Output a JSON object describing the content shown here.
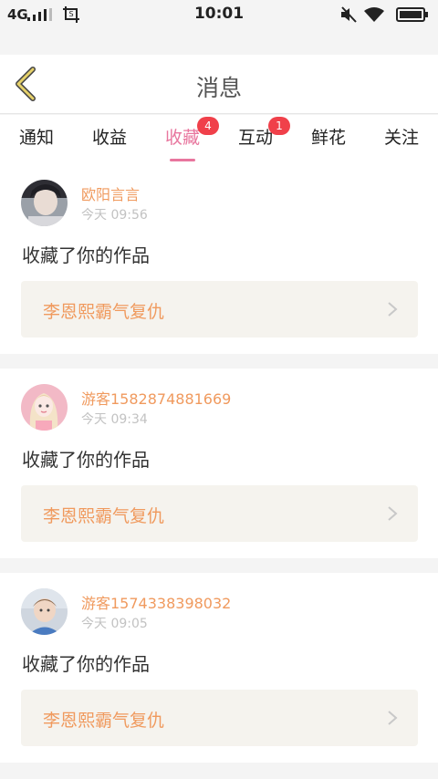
{
  "status_bar": {
    "network": "4G",
    "time": "10:01"
  },
  "header": {
    "title": "消息"
  },
  "tabs": [
    {
      "label": "通知"
    },
    {
      "label": "收益"
    },
    {
      "label": "收藏",
      "badge": "4",
      "active": true
    },
    {
      "label": "互动",
      "badge": "1"
    },
    {
      "label": "鲜花"
    },
    {
      "label": "关注"
    }
  ],
  "messages": [
    {
      "user": "欧阳言言",
      "time": "今天 09:56",
      "text": "收藏了你的作品",
      "work": "李恩熙霸气复仇"
    },
    {
      "user": "游客1582874881669",
      "time": "今天 09:34",
      "text": "收藏了你的作品",
      "work": "李恩熙霸气复仇"
    },
    {
      "user": "游客1574338398032",
      "time": "今天 09:05",
      "text": "收藏了你的作品",
      "work": "李恩熙霸气复仇"
    }
  ],
  "colors": {
    "accent": "#e8769e",
    "name": "#f09a5e",
    "badge": "#f0404a",
    "back_arrow": "#e6d16a"
  }
}
